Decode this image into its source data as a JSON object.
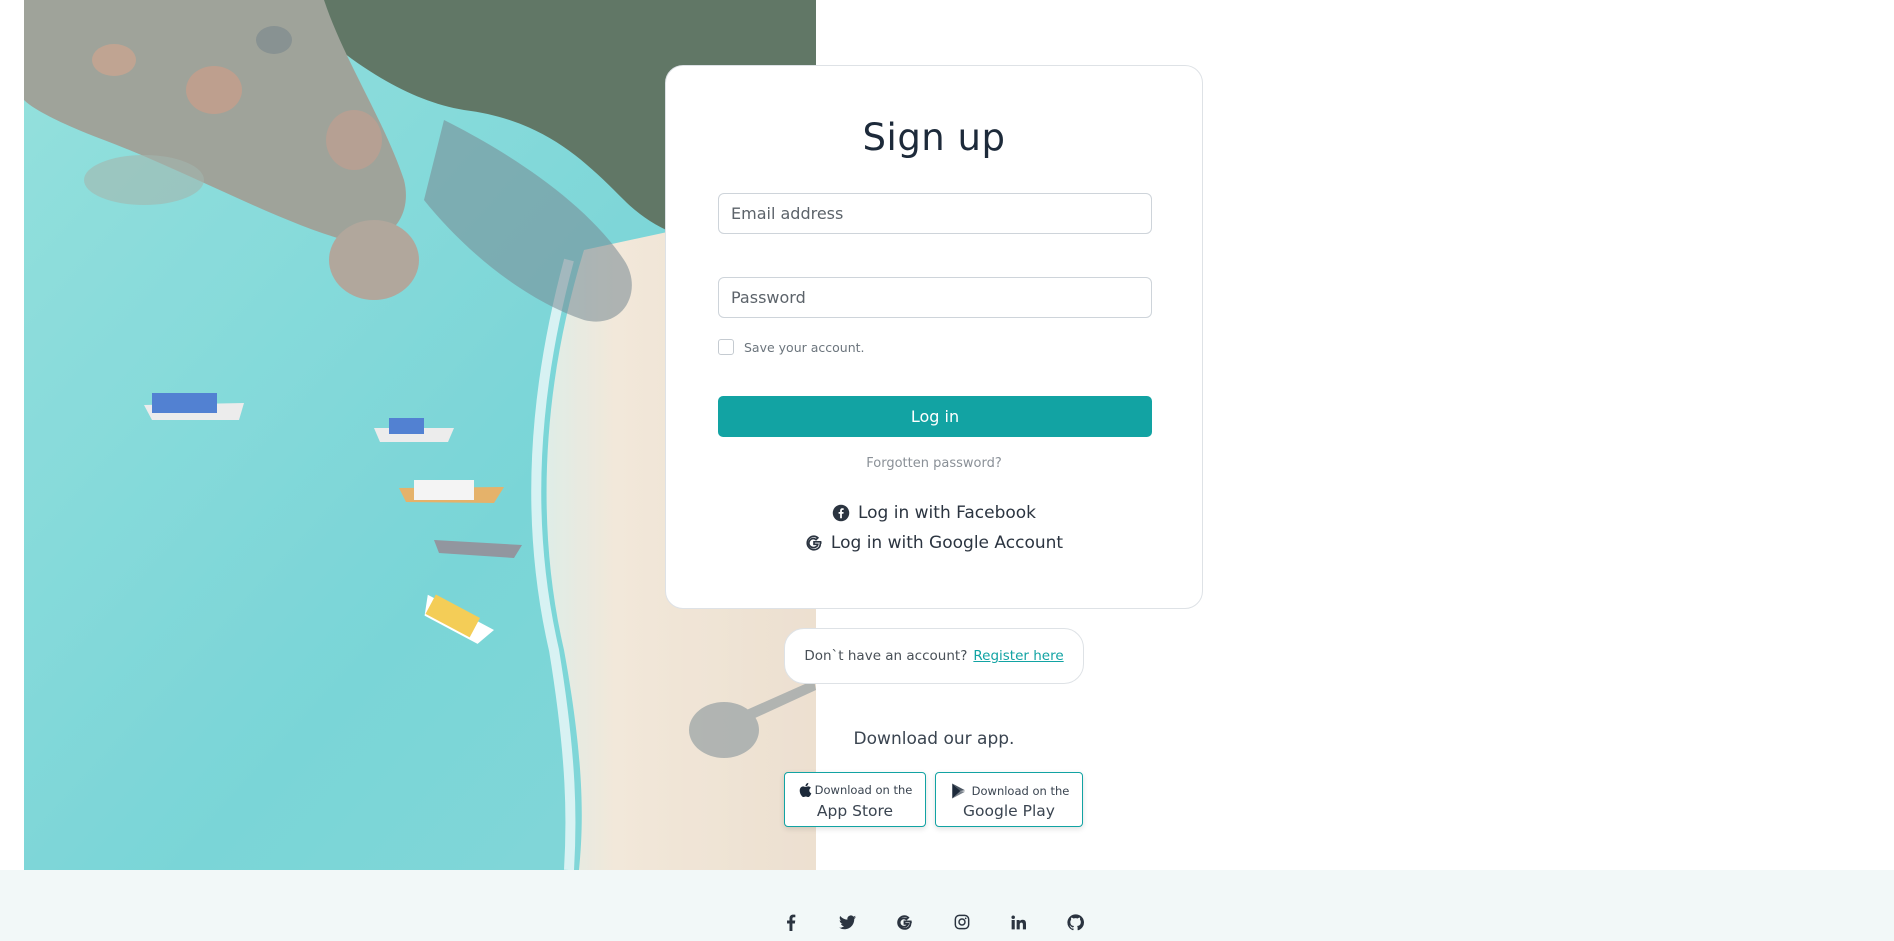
{
  "signup": {
    "title": "Sign up",
    "email_placeholder": "Email address",
    "password_placeholder": "Password",
    "remember_label": "Save your account.",
    "login_button": "Log in",
    "forgot_link": "Forgotten password?",
    "facebook_login": "Log in with Facebook",
    "google_login": "Log in with Google Account"
  },
  "register": {
    "prompt": "Don`t have an account?",
    "link": "Register here"
  },
  "download": {
    "title": "Download our app.",
    "app_store": {
      "small": "Download on the",
      "big": "App Store"
    },
    "google_play": {
      "small": "Download on the",
      "big": "Google Play"
    }
  },
  "footer": {
    "icons": [
      "facebook-icon",
      "twitter-icon",
      "google-icon",
      "instagram-icon",
      "linkedin-icon",
      "github-icon"
    ]
  },
  "colors": {
    "accent": "#12a3a3",
    "footer_bg": "#f2f8f8",
    "text_dark": "#1d2a3a"
  }
}
